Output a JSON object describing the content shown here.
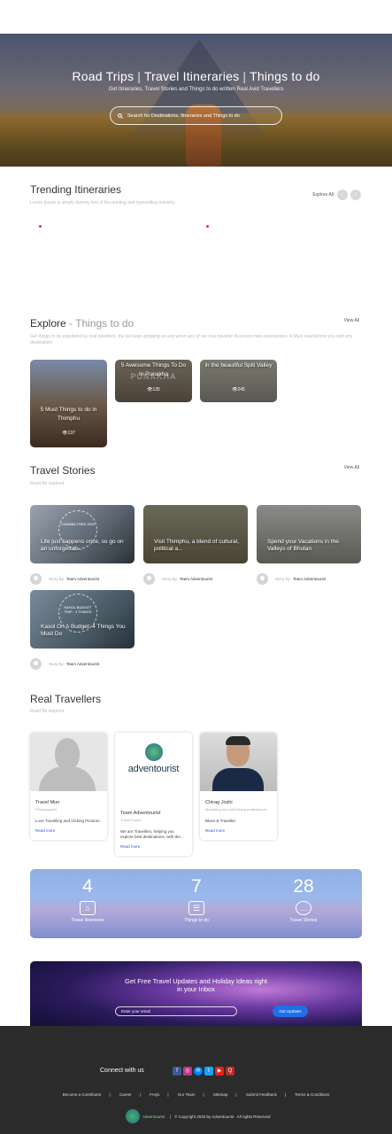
{
  "hero": {
    "title_parts": [
      "Road Trips",
      "Travel Itineraries",
      "Things to do"
    ],
    "subtitle": "Get Itineraries, Travel Stories and Things to do written Real Avid Travellers",
    "search_placeholder": "Search for Destinations, Itineraries and Things to do"
  },
  "trending": {
    "title": "Trending Itineraries",
    "subtitle": "Lorem Ipsum is simply dummy text of the printing and typesetting industry.",
    "explore_all": "Explore All",
    "prev": "‹",
    "next": "›"
  },
  "explore": {
    "title": "Explore",
    "title_accent": "- Things to do",
    "description": "Get things to do populated by real travellers, the list keep updating as and when any of our real traveller discovers new experiences. A Must read before you visit any destination!",
    "view_all": "View All",
    "cards": [
      {
        "title": "5 Must Things to do in Thimphu",
        "views": "137"
      },
      {
        "title": "5 Awesome Things To Do In Punakha",
        "overlay": "PUNAKHA",
        "views": "135"
      },
      {
        "title": "in the beautiful Spiti Valley",
        "views": "245"
      }
    ]
  },
  "stories": {
    "title": "Travel Stories",
    "subtitle": "Read Be inspired",
    "view_all": "View All",
    "items": [
      {
        "title": "Life just happens once, so go on an unforgettab...",
        "overlay": "CHAMBA TREK 2020",
        "by_label": "Story By",
        "author": "Team Adventourist"
      },
      {
        "title": "Visit Thimphu, a blend of cultural, political a...",
        "by_label": "Story By",
        "author": "Team Adventourist"
      },
      {
        "title": "Spend your Vacations in the Valleys of Bhutan",
        "by_label": "Story By",
        "author": "Team Adventourist"
      },
      {
        "title": "Kasol On A Budget: 4 Things You Must Do",
        "overlay": "KASOL BUDGET TRIP - 4 THINGS",
        "by_label": "Story By",
        "author": "Team Adventourist"
      }
    ]
  },
  "travellers": {
    "title": "Real Travellers",
    "subtitle": "Read Be inspired",
    "items": [
      {
        "name": "Travel Mun",
        "role": "Photographer",
        "bio": "Love Travelling and clicking Pictures.",
        "read_more": "Read more"
      },
      {
        "name": "Team Adventourist",
        "role": "Travel Expert",
        "bio": "We are Travellers, helping you explore best destinations, with the...",
        "read_more": "Read more",
        "logo_text": "adventourist"
      },
      {
        "name": "Chirag Joshi",
        "role": "Marketing and Advertising professional",
        "bio": "Blues & Traveller.",
        "read_more": "Read more"
      }
    ]
  },
  "stats": [
    {
      "number": "4",
      "label": "Travel Itineraries",
      "icon": "map-icon"
    },
    {
      "number": "7",
      "label": "Things to do",
      "icon": "checklist-icon"
    },
    {
      "number": "28",
      "label": "Travel Stories",
      "icon": "chat-icon"
    }
  ],
  "newsletter": {
    "heading_line1": "Get Free Travel Updates and Holiday Ideas right",
    "heading_line2": "in your Inbox",
    "email_placeholder": "Enter your email",
    "button": "Get Updates"
  },
  "footer": {
    "connect": "Connect with us",
    "social": [
      {
        "name": "facebook-icon",
        "glyph": "f",
        "color": "#3b5998"
      },
      {
        "name": "instagram-icon",
        "glyph": "◎",
        "color": "#c13584"
      },
      {
        "name": "messenger-icon",
        "glyph": "✉",
        "color": "#0084ff"
      },
      {
        "name": "twitter-icon",
        "glyph": "t",
        "color": "#1da1f2"
      },
      {
        "name": "youtube-icon",
        "glyph": "▶",
        "color": "#e62117"
      },
      {
        "name": "quora-icon",
        "glyph": "Q",
        "color": "#b92b27"
      }
    ],
    "links": [
      "Become a Contributor",
      "Career",
      "FAQs",
      "Our Team",
      "Sitemap",
      "Submit Feedback",
      "Terms & Conditions"
    ],
    "brand": "Adventourist",
    "copyright": "© Copyright 2020 by Adventourist . All rights Reserved"
  },
  "colors": {
    "accent": "#1e6fe8",
    "dark_footer": "#2b2b2b",
    "red_dot": "#e0304a"
  }
}
